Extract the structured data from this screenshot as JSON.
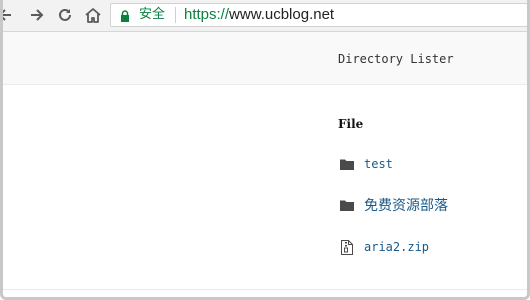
{
  "browser": {
    "security_label": "安全",
    "url_scheme": "https://",
    "url_host": "www.ucblog.net",
    "secure_color": "#0b8043",
    "nav_icons": [
      "back-icon",
      "forward-icon",
      "reload-icon",
      "home-icon",
      "lock-icon"
    ]
  },
  "page": {
    "title": "Directory Lister",
    "list_heading": "File",
    "items": [
      {
        "name": "test",
        "icon": "folder-icon",
        "type": "folder"
      },
      {
        "name": "免费资源部落",
        "icon": "folder-icon",
        "type": "folder"
      },
      {
        "name": "aria2.zip",
        "icon": "zip-file-icon",
        "type": "file"
      }
    ],
    "link_color": "#1a5a8a"
  }
}
